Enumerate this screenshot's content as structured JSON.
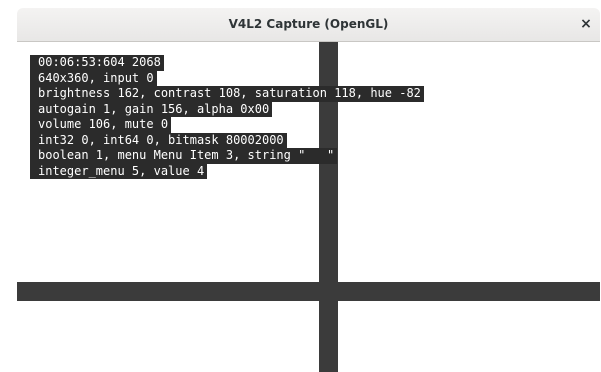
{
  "window": {
    "title": "V4L2 Capture (OpenGL)",
    "close_glyph": "×"
  },
  "osd": {
    "lines": [
      "00:06:53:604 2068",
      "640x360, input 0",
      "brightness 162, contrast 108, saturation 118, hue -82",
      "autogain 1, gain 156, alpha 0x00",
      "volume 106, mute 0",
      "int32 0, int64 0, bitmask 80002000",
      "boolean 1, menu Menu Item 3, string \"   \"",
      "integer_menu 5, value 4"
    ]
  },
  "colors": {
    "bars": "#3b3b3b",
    "osd_background": "#2b2b2b",
    "osd_text": "#ffffff",
    "video_background": "#ffffff"
  }
}
